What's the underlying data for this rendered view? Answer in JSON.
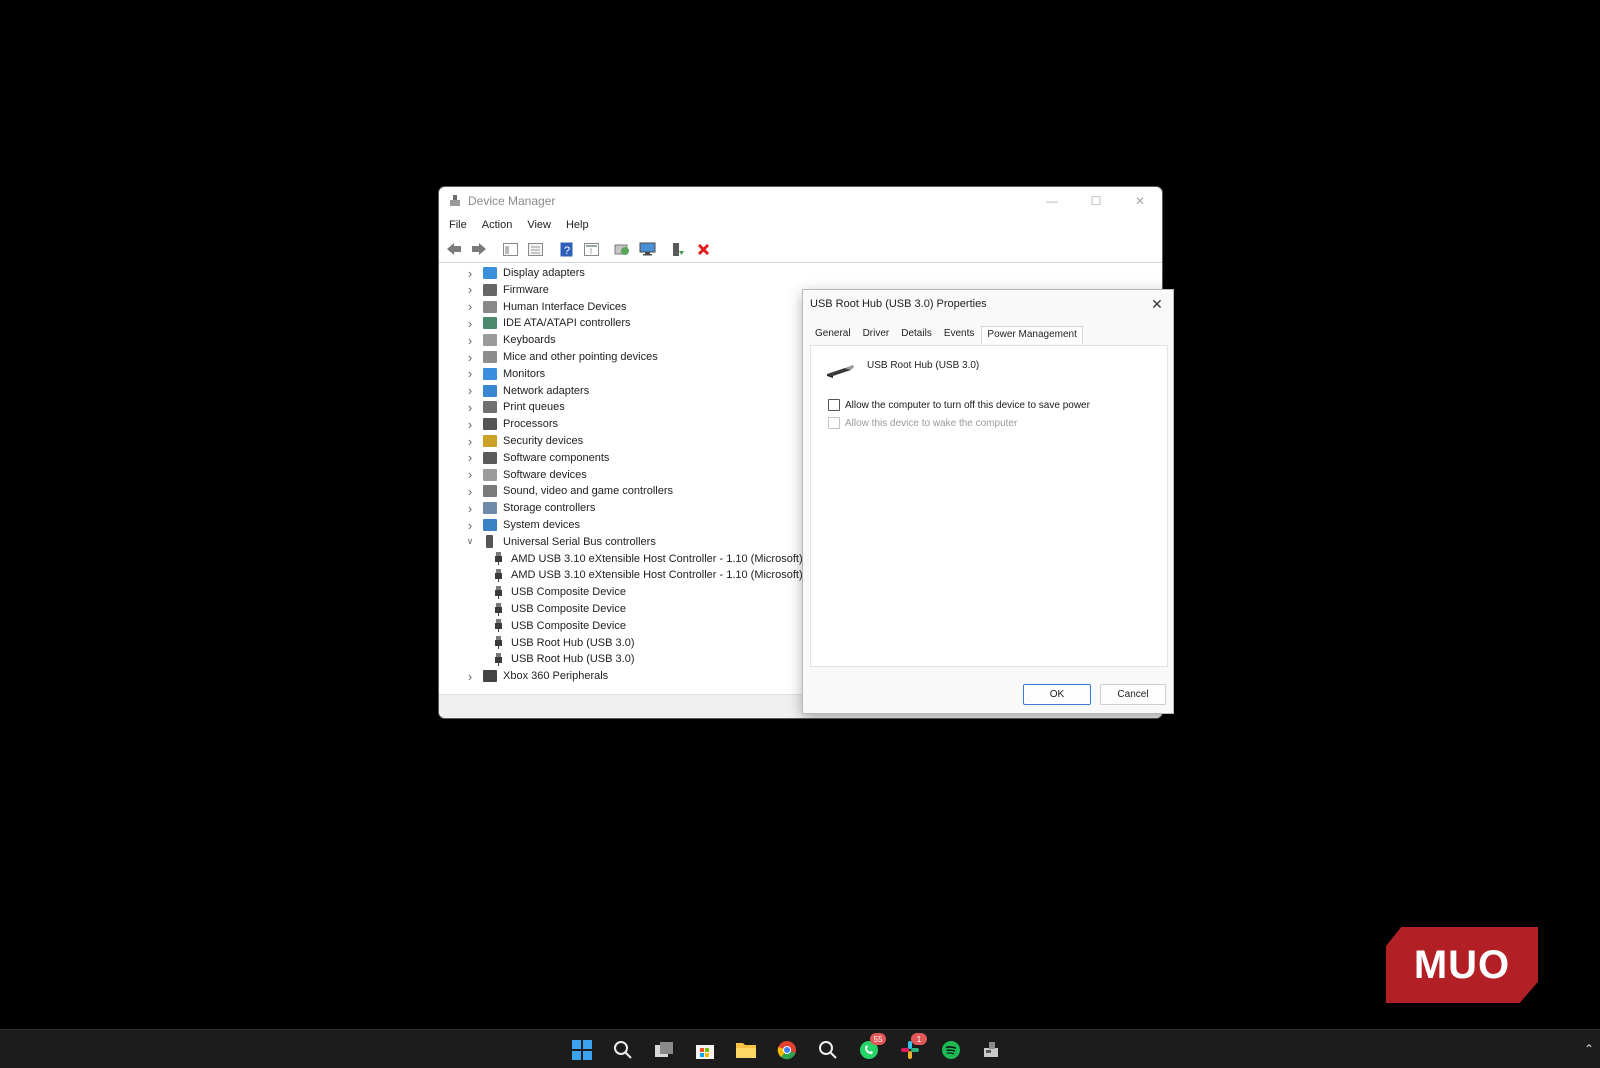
{
  "device_manager": {
    "title": "Device Manager",
    "menu": [
      "File",
      "Action",
      "View",
      "Help"
    ],
    "toolbar_icons": [
      "back-icon",
      "forward-icon",
      "properties-pane-icon",
      "view-icon",
      "help-icon",
      "view-toggle-icon",
      "scan-hardware-icon",
      "monitor-icon",
      "update-driver-icon",
      "uninstall-icon"
    ],
    "tree": [
      {
        "label": "Display adapters",
        "icon": "display-adapter-icon",
        "color": "#3a8fd8",
        "expanded": false
      },
      {
        "label": "Firmware",
        "icon": "firmware-icon",
        "color": "#666666",
        "expanded": false
      },
      {
        "label": "Human Interface Devices",
        "icon": "hid-icon",
        "color": "#888888",
        "expanded": false
      },
      {
        "label": "IDE ATA/ATAPI controllers",
        "icon": "ide-icon",
        "color": "#4c8a6e",
        "expanded": false
      },
      {
        "label": "Keyboards",
        "icon": "keyboard-icon",
        "color": "#9a9a9a",
        "expanded": false
      },
      {
        "label": "Mice and other pointing devices",
        "icon": "mouse-icon",
        "color": "#8d8d8d",
        "expanded": false
      },
      {
        "label": "Monitors",
        "icon": "monitor-icon",
        "color": "#3c8ee0",
        "expanded": false
      },
      {
        "label": "Network adapters",
        "icon": "network-adapter-icon",
        "color": "#3a86d1",
        "expanded": false
      },
      {
        "label": "Print queues",
        "icon": "printer-icon",
        "color": "#6f6f6f",
        "expanded": false
      },
      {
        "label": "Processors",
        "icon": "processor-icon",
        "color": "#555555",
        "expanded": false
      },
      {
        "label": "Security devices",
        "icon": "security-device-icon",
        "color": "#c9a227",
        "expanded": false
      },
      {
        "label": "Software components",
        "icon": "software-component-icon",
        "color": "#5b5b5b",
        "expanded": false
      },
      {
        "label": "Software devices",
        "icon": "software-device-icon",
        "color": "#9c9c9c",
        "expanded": false
      },
      {
        "label": "Sound, video and game controllers",
        "icon": "speaker-icon",
        "color": "#7a7a7a",
        "expanded": false
      },
      {
        "label": "Storage controllers",
        "icon": "storage-controller-icon",
        "color": "#6e8aa8",
        "expanded": false
      },
      {
        "label": "System devices",
        "icon": "system-device-icon",
        "color": "#3b82c4",
        "expanded": false
      },
      {
        "label": "Universal Serial Bus controllers",
        "icon": "usb-icon",
        "color": "#555555",
        "expanded": true
      },
      {
        "label": "AMD USB 3.10 eXtensible Host Controller - 1.10 (Microsoft)",
        "icon": "usb-icon",
        "child": true
      },
      {
        "label": "AMD USB 3.10 eXtensible Host Controller - 1.10 (Microsoft)",
        "icon": "usb-icon",
        "child": true
      },
      {
        "label": "USB Composite Device",
        "icon": "usb-icon",
        "child": true
      },
      {
        "label": "USB Composite Device",
        "icon": "usb-icon",
        "child": true
      },
      {
        "label": "USB Composite Device",
        "icon": "usb-icon",
        "child": true
      },
      {
        "label": "USB Root Hub (USB 3.0)",
        "icon": "usb-icon",
        "child": true
      },
      {
        "label": "USB Root Hub (USB 3.0)",
        "icon": "usb-icon",
        "child": true
      },
      {
        "label": "Xbox 360 Peripherals",
        "icon": "gamepad-icon",
        "color": "#444444",
        "expanded": false
      }
    ]
  },
  "properties_dialog": {
    "title": "USB Root Hub (USB 3.0) Properties",
    "tabs": [
      "General",
      "Driver",
      "Details",
      "Events",
      "Power Management"
    ],
    "active_tab": "Power Management",
    "device_name": "USB Root Hub (USB 3.0)",
    "option_allow_turn_off": "Allow the computer to turn off this device to save power",
    "option_allow_turn_off_checked": false,
    "option_allow_wake": "Allow this device to wake the computer",
    "option_allow_wake_enabled": false,
    "ok_label": "OK",
    "cancel_label": "Cancel"
  },
  "taskbar": {
    "icons": [
      {
        "name": "start-icon"
      },
      {
        "name": "search-icon"
      },
      {
        "name": "task-view-icon"
      },
      {
        "name": "store-icon"
      },
      {
        "name": "file-explorer-icon"
      },
      {
        "name": "chrome-icon"
      },
      {
        "name": "search-app-icon"
      },
      {
        "name": "whatsapp-icon",
        "badge": "55"
      },
      {
        "name": "slack-icon",
        "badge": "1"
      },
      {
        "name": "spotify-icon"
      },
      {
        "name": "device-manager-icon"
      }
    ]
  },
  "watermark": {
    "text": "MUO"
  }
}
